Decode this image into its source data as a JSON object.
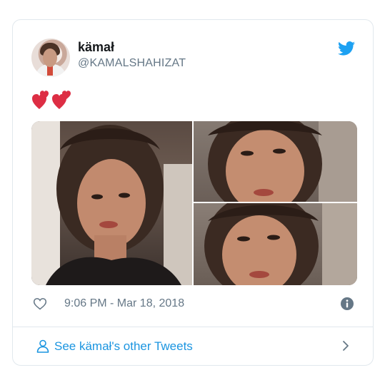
{
  "author": {
    "display_name": "kämał",
    "handle": "@KAMALSHAHIZAT",
    "avatar_icon": "user-avatar"
  },
  "tweet": {
    "emoji": "💕",
    "media_count": 3
  },
  "meta": {
    "timestamp": "9:06 PM - Mar 18, 2018"
  },
  "footer": {
    "link_label": "See kämał's other Tweets"
  },
  "icons": {
    "brand": "twitter-bird-icon",
    "like": "heart-icon",
    "info": "info-icon",
    "profile": "person-icon",
    "chevron": "chevron-right-icon"
  },
  "colors": {
    "brand_blue": "#1da1f2",
    "link_blue": "#1b95e0",
    "heart_red": "#dd2e44",
    "secondary_text": "#657786",
    "border": "#e1e8ed"
  }
}
